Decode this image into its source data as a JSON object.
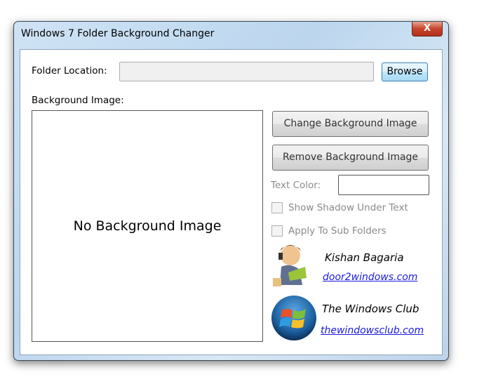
{
  "window": {
    "title": "Windows 7 Folder Background Changer",
    "close_label": "X"
  },
  "folder": {
    "label": "Folder Location:",
    "value": "",
    "browse_label": "Browse"
  },
  "background": {
    "label": "Background Image:",
    "placeholder": "No Background Image"
  },
  "actions": {
    "change_label": "Change Background Image",
    "remove_label": "Remove Background Image"
  },
  "options": {
    "text_color_label": "Text Color:",
    "shadow_label": "Show Shadow Under Text",
    "subfolders_label": "Apply To Sub Folders"
  },
  "credits": [
    {
      "name": "Kishan Bagaria",
      "link": "door2windows.com"
    },
    {
      "name": "The Windows Club",
      "link": "thewindowsclub.com"
    }
  ]
}
